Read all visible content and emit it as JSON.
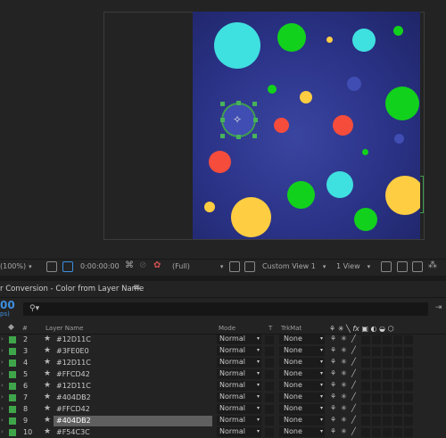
{
  "colors": {
    "background": "#232323",
    "accent_blue": "#3d8fe0",
    "label_green": "#3fa54a",
    "comp_bg": "#2a3286",
    "cyan": "#3fe0e0",
    "green": "#12d11c",
    "yellow": "#ffcd42",
    "red": "#f54c3c",
    "blue": "#404db2"
  },
  "viewer": {
    "zoom": "(100%)",
    "timecode": "0:00:00:00",
    "resolution": "(Full)",
    "view": "Custom View 1",
    "views_count": "1 View",
    "icons": [
      "camera-icon",
      "channel-icon",
      "color-icon",
      "region-icon",
      "grid-icon",
      "snapshot-icon",
      "fast-preview-icon",
      "share-icon"
    ]
  },
  "panel": {
    "title": "r Conversion - Color from Layer Name",
    "menu_icon": "hamburger-menu-icon"
  },
  "timeline": {
    "timecode": "00",
    "fps": "ps)",
    "search_placeholder": "",
    "search_icon": "search-icon"
  },
  "columns": {
    "label": "label-icon",
    "hash": "#",
    "layer_name": "Layer Name",
    "mode": "Mode",
    "t": "T",
    "trkmat": "TrkMat",
    "switches": "❀ ✲ \\ fx"
  },
  "layers": [
    {
      "num": "2",
      "name": "#12D11C",
      "mode": "Normal",
      "trkmat": "None"
    },
    {
      "num": "3",
      "name": "#3FE0E0",
      "mode": "Normal",
      "trkmat": "None"
    },
    {
      "num": "4",
      "name": "#12D11C",
      "mode": "Normal",
      "trkmat": "None"
    },
    {
      "num": "5",
      "name": "#FFCD42",
      "mode": "Normal",
      "trkmat": "None"
    },
    {
      "num": "6",
      "name": "#12D11C",
      "mode": "Normal",
      "trkmat": "None"
    },
    {
      "num": "7",
      "name": "#404DB2",
      "mode": "Normal",
      "trkmat": "None"
    },
    {
      "num": "8",
      "name": "#FFCD42",
      "mode": "Normal",
      "trkmat": "None"
    },
    {
      "num": "9",
      "name": "#404DB2",
      "mode": "Normal",
      "trkmat": "None",
      "selected": true
    },
    {
      "num": "10",
      "name": "#F54C3C",
      "mode": "Normal",
      "trkmat": "None"
    }
  ]
}
